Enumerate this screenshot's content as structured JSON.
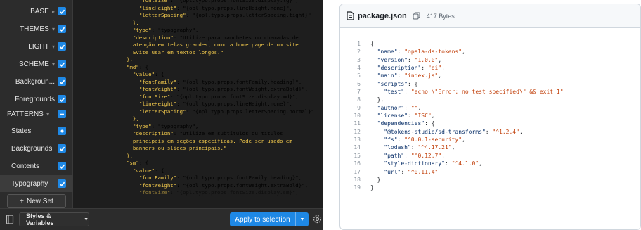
{
  "token_sets": [
    {
      "label": "BASE",
      "group": true
    },
    {
      "label": "THEMES",
      "group": true
    },
    {
      "label": "LIGHT",
      "group": true
    },
    {
      "label": "SCHEME",
      "group": true
    },
    {
      "label": "Backgroun...",
      "group": false
    },
    {
      "label": "Foregrounds",
      "group": false
    },
    {
      "label": "PATTERNS",
      "group": true
    },
    {
      "label": "States",
      "group": false
    },
    {
      "label": "Backgrounds",
      "group": false
    },
    {
      "label": "Contents",
      "group": false
    },
    {
      "label": "Typography",
      "group": false
    }
  ],
  "new_set_label": "New Set",
  "json_editor_lines": [
    {
      "t": "    \"fontSize\": \"{opl.typo.props.fontSize.display.lg}\","
    },
    {
      "t": "    \"lineHeight\": \"{opl.typo.props.lineHeight.none}\","
    },
    {
      "t": "    \"letterSpacing\": \"{opl.typo.props.letterSpacing.tight}\""
    },
    {
      "t": "  },"
    },
    {
      "t": "  \"type\": \"typography\","
    },
    {
      "t": "  \"description\": \"Utilize para manchetes ou chamadas de"
    },
    {
      "t": "  atenção em telas grandes, como a home page de um site."
    },
    {
      "t": "  Evite usar em textos longos.\""
    },
    {
      "t": "},"
    },
    {
      "t": "\"md\": {"
    },
    {
      "t": "  \"value\": {"
    },
    {
      "t": "    \"fontFamily\": \"{opl.typo.props.fontFamily.heading}\","
    },
    {
      "t": "    \"fontWeight\": \"{opl.typo.props.fontWeight.extraBold}\","
    },
    {
      "t": "    \"fontSize\": \"{opl.typo.props.fontSize.display.md}\","
    },
    {
      "t": "    \"lineHeight\": \"{opl.typo.props.lineHeight.none}\","
    },
    {
      "t": "    \"letterSpacing\": \"{opl.typo.props.letterSpacing.normal}\""
    },
    {
      "t": "  },"
    },
    {
      "t": "  \"type\": \"typography\","
    },
    {
      "t": "  \"description\": \"Utilize em subtítulos ou títulos"
    },
    {
      "t": "  principais em seções específicas. Pode ser usado em"
    },
    {
      "t": "  banners ou slides principais.\""
    },
    {
      "t": "},"
    },
    {
      "t": "\"sm\": {"
    },
    {
      "t": "  \"value\": {"
    },
    {
      "t": "    \"fontFamily\": \"{opl.typo.props.fontFamily.heading}\","
    },
    {
      "t": "    \"fontWeight\": \"{opl.typo.props.fontWeight.extraBold}\","
    },
    {
      "t": "    \"fontSize\": \"{opl.typo.props.fontSize.display.sm}\","
    }
  ],
  "footer": {
    "theme_select": "Styles & Variables",
    "apply_label": "Apply to selection"
  },
  "file": {
    "name": "package.json",
    "size": "417 Bytes",
    "lines": [
      {
        "n": "1",
        "t": "{"
      },
      {
        "n": "2",
        "t": "  \"name\": \"opala-ds-tokens\","
      },
      {
        "n": "3",
        "t": "  \"version\": \"1.0.0\","
      },
      {
        "n": "4",
        "t": "  \"description\": \"oi\","
      },
      {
        "n": "5",
        "t": "  \"main\": \"index.js\","
      },
      {
        "n": "6",
        "t": "  \"scripts\": {"
      },
      {
        "n": "7",
        "t": "    \"test\": \"echo \\\"Error: no test specified\\\" && exit 1\""
      },
      {
        "n": "8",
        "t": "  },"
      },
      {
        "n": "9",
        "t": "  \"author\": \"\","
      },
      {
        "n": "10",
        "t": "  \"license\": \"ISC\","
      },
      {
        "n": "11",
        "t": "  \"dependencies\": {"
      },
      {
        "n": "12",
        "t": "    \"@tokens-studio/sd-transforms\": \"^1.2.4\","
      },
      {
        "n": "13",
        "t": "    \"fs\": \"^0.0.1-security\","
      },
      {
        "n": "14",
        "t": "    \"lodash\": \"^4.17.21\","
      },
      {
        "n": "15",
        "t": "    \"path\": \"^0.12.7\","
      },
      {
        "n": "16",
        "t": "    \"style-dictionary\": \"^4.1.0\","
      },
      {
        "n": "17",
        "t": "    \"url\": \"^0.11.4\""
      },
      {
        "n": "18",
        "t": "  }"
      },
      {
        "n": "19",
        "t": "}"
      }
    ]
  },
  "colors": {
    "accent": "#1e88e5",
    "panel_bg": "#1e1e1e",
    "json_key": "#f2c94c",
    "gh_key": "#0a3069",
    "gh_string": "#c2410c"
  }
}
